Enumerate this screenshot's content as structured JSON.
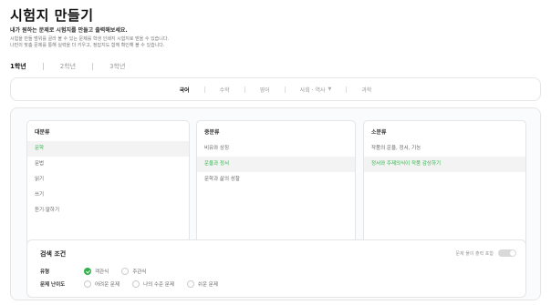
{
  "page": {
    "title": "시험지 만들기",
    "subtitle": "내가 원하는 문제로 시험지를 만들고 출력해보세요.",
    "desc_line1": "시험을 만들 범위를 골라 볼 수 있는 문제를 학생 인쇄지 시험지로 받을 수 있습니다.",
    "desc_line2": "나만의 맞춤 문제를 통해 실력을 더 키우고, 정답지도 함께 확인해 볼 수 있습니다."
  },
  "grade_tabs": [
    "1학년",
    "2학년",
    "3학년"
  ],
  "subjects": [
    {
      "label": "국어",
      "active": true
    },
    {
      "label": "수학",
      "active": false
    },
    {
      "label": "영어",
      "active": false
    },
    {
      "label": "사회 · 역사",
      "active": false,
      "dropdown": true
    },
    {
      "label": "과학",
      "active": false
    }
  ],
  "categories": {
    "major": {
      "header": "대분류",
      "items": [
        "문학",
        "문법",
        "읽기",
        "쓰기",
        "듣기·말하기"
      ],
      "selected_index": 0
    },
    "middle": {
      "header": "중분류",
      "items": [
        "비유와 상징",
        "운율과 정서",
        "문학과 삶의 성찰"
      ],
      "selected_index": 1
    },
    "minor": {
      "header": "소분류",
      "items": [
        "작품의 운율, 정서, 기능",
        "정서와 주제의식이 작품 감상하기"
      ],
      "selected_index": 1
    }
  },
  "conditions": {
    "title": "검색 조건",
    "toggle_label": "문제 풀이 출력 포함",
    "toggle_on": false,
    "type_row": {
      "label": "유형",
      "options": [
        "객관식",
        "주관식"
      ],
      "selected_index": 0
    },
    "difficulty_row": {
      "label": "문제 난이도",
      "options": [
        "어려운 문제",
        "나의 수준 문제",
        "쉬운 문제"
      ],
      "selected_index": -1
    }
  },
  "colors": {
    "accent": "#2fb34a",
    "selected_bg": "#f3f3f3",
    "border": "#e5e5e5"
  }
}
